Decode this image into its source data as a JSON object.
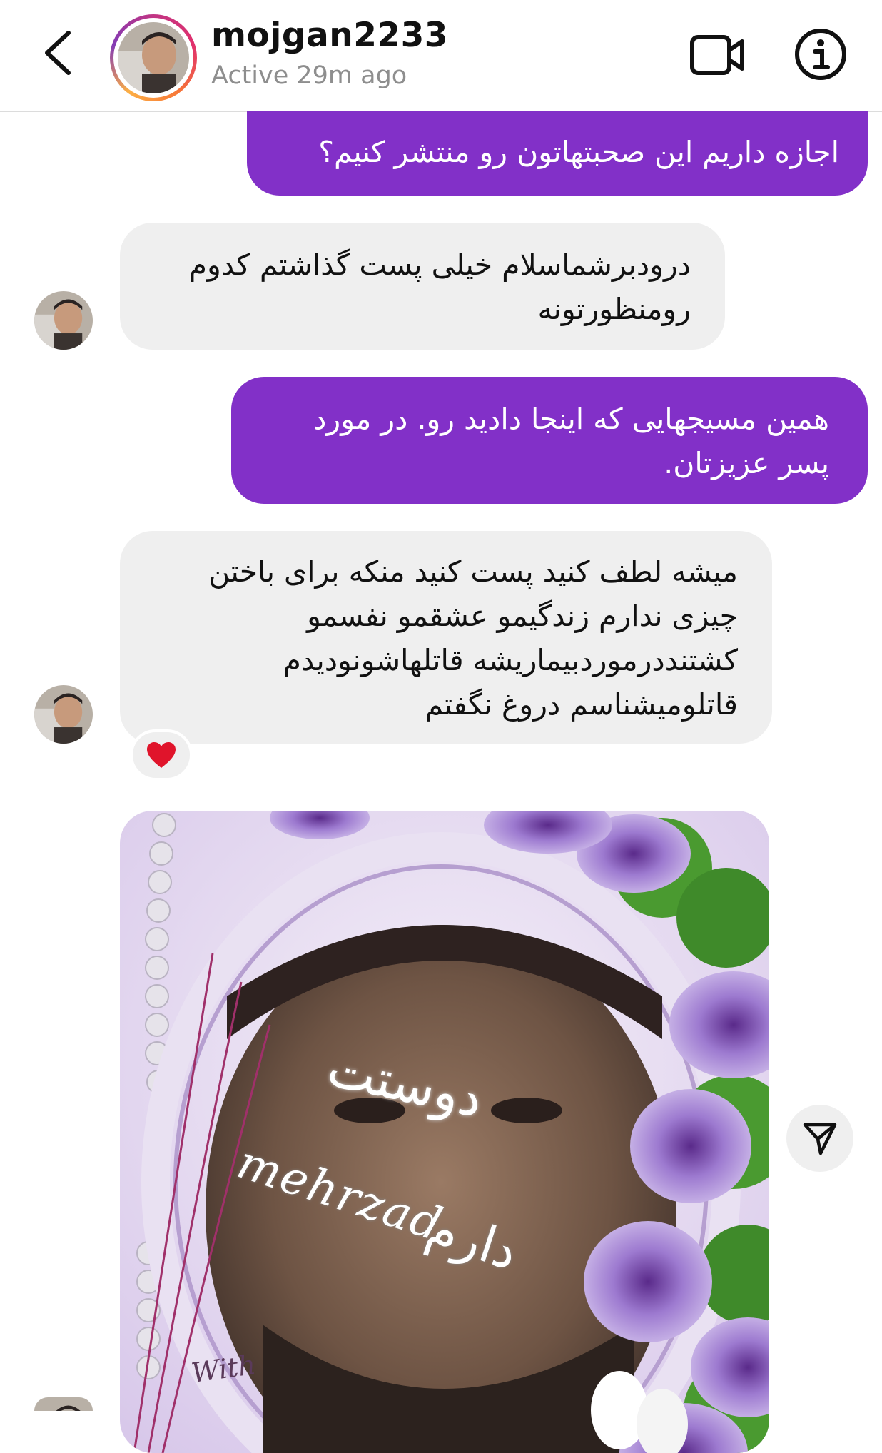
{
  "header": {
    "username": "mojgan2233",
    "status": "Active 29m ago",
    "icons": {
      "back": "chevron-left-icon",
      "video": "video-camera-icon",
      "info": "info-icon"
    }
  },
  "messages": [
    {
      "direction": "outgoing",
      "text": "اجازه داریم این صحبتهاتون رو منتشر کنیم؟"
    },
    {
      "direction": "incoming",
      "lines": [
        "درودبرشماسلام خیلی پست گذاشتم کدوم",
        "رومنظورتونه"
      ]
    },
    {
      "direction": "outgoing",
      "lines": [
        "همین مسیجهایی که اینجا دادید رو. در مورد",
        "پسر عزیزتان."
      ]
    },
    {
      "direction": "incoming",
      "lines": [
        "میشه لطف کنید پست کنید منکه برای باختن",
        "چیزی ندارم زندگیمو عشقمو نفسمو",
        "کشتنددرموردبیماریشه قاتلهاشونودیدم",
        "قاتلومیشناسم دروغ نگفتم"
      ],
      "reaction": "❤️"
    },
    {
      "direction": "incoming",
      "type": "image",
      "overlay": {
        "fa_top": "دوستت",
        "en": "mehrzad",
        "fa_bottom": "دارم",
        "signature": "With"
      }
    }
  ],
  "colors": {
    "outgoing_bubble": "#8230c8",
    "incoming_bubble": "#efefef",
    "status_text": "#8e8e8e"
  },
  "share_icon": "send-icon"
}
